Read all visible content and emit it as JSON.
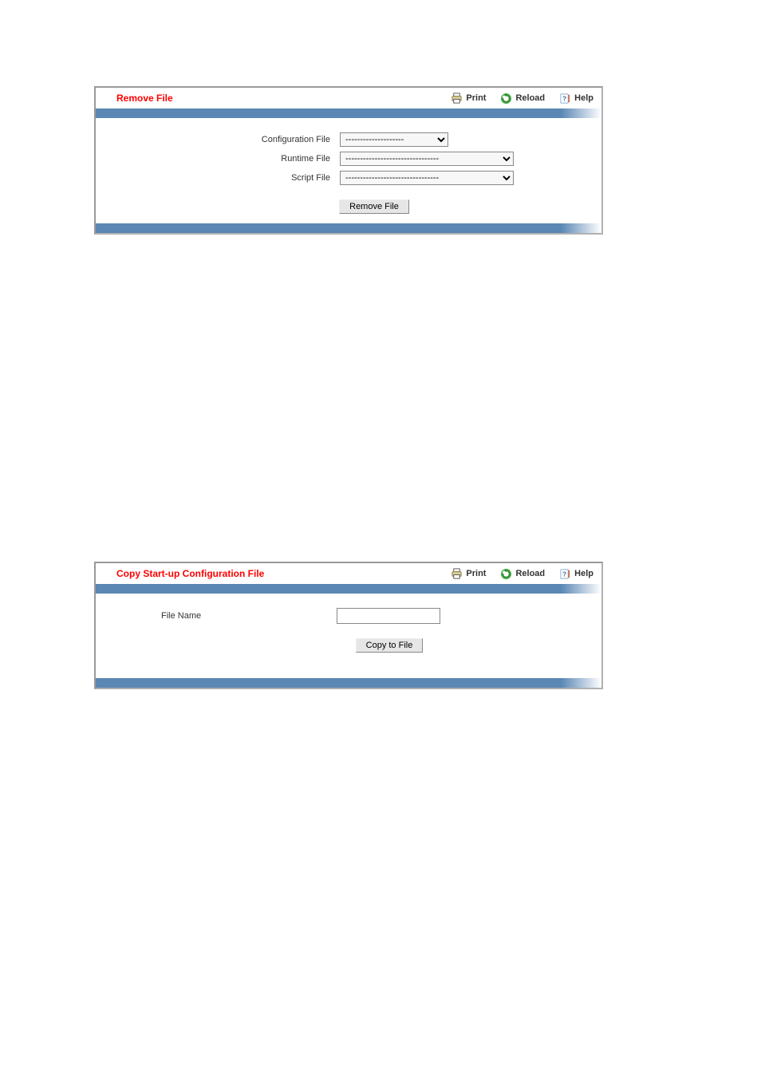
{
  "toolbar": {
    "print_label": "Print",
    "reload_label": "Reload",
    "help_label": "Help"
  },
  "panels": {
    "remove": {
      "title": "Remove File",
      "fields": {
        "config_label": "Configuration File",
        "runtime_label": "Runtime File",
        "script_label": "Script File",
        "select_placeholder_short": "--------------------",
        "select_placeholder_long": "--------------------------------"
      },
      "button": "Remove File"
    },
    "copy": {
      "title": "Copy Start-up Configuration File",
      "fields": {
        "filename_label": "File Name"
      },
      "button": "Copy to File"
    }
  }
}
